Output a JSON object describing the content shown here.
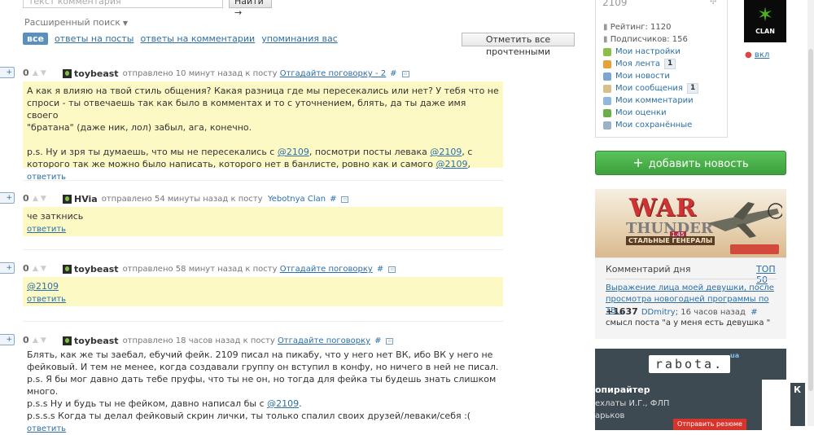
{
  "search": {
    "placeholder": "текст комментария",
    "button": "Найти →"
  },
  "advanced_search": "Расширенный поиск",
  "filters": {
    "active": "все",
    "items": [
      "ответы на посты",
      "ответы на комментарии",
      "упоминания вас"
    ]
  },
  "mark_all_read": "Отметить все прочтенными",
  "comments": [
    {
      "score": "0",
      "user": "toybeast",
      "meta": "отправлено 10 минут назад к посту",
      "post_link": "Отгадайте поговорку - 2",
      "lines": [
        "А как я влияю на твой стиль общения? Какая разница где мы пересекались или нет? У тебя что не",
        "спроси - ты отвечаешь так как было в комментах и то с уточнением, блять, да ты даже имя своего",
        "\"братана\" (даже ник, лол) забыл, ага, конечно."
      ],
      "ps_prefix": "p.s. Ну и зря ты думаешь, что мы не пересекались с ",
      "mention": "@2109",
      "ps_mid": ", посмотри посты левака ",
      "mention2": "@2109",
      "ps_mid2": ", с",
      "ps_line2": "которого так же можно было написать, которого нет в банлисте, ровно как и самого ",
      "mention3": "@2109",
      "ps_end": ",",
      "reply": "ответить"
    },
    {
      "score": "0",
      "user": "HVia",
      "meta": "отправлено 54 минуты назад к посту",
      "post_link": "Yebotnya Clan",
      "text": "че заткнись",
      "reply": "ответить"
    },
    {
      "score": "0",
      "user": "toybeast",
      "meta": "отправлено 58 минут назад к посту",
      "post_link": "Отгадайте поговорку",
      "mention": "@2109",
      "reply": "ответить"
    },
    {
      "score": "0",
      "user": "toybeast",
      "meta": "отправлено 18 часов назад к посту",
      "post_link": "Отгадайте поговорку",
      "lines": [
        "Блять, как же ты заебал, ебучий фейк. 2109 писал на пикабу, что у него нет ВК, ибо ВК у него не",
        "фейковый. И тем не менее, когда создавали группу он вступил в конфу, но ничего в ней не писал.",
        "p.s. Я бы мог давно дать тебе пруфы, что ты не он, но тогда для фейка ты будешь знать слишком",
        "много."
      ],
      "pss_prefix": "p.s.s Ну и будь ты не фейком, давно написал бы с ",
      "mention": "@2109",
      "pss_end": ".",
      "psss": "p.s.s.s Когда ты делал фейковый скрин лички, ты только спалил своих друзей/леваки/себя :(",
      "reply": "ответить"
    }
  ],
  "plus_label": "+",
  "hash": "#",
  "user_panel": {
    "username": "2109",
    "rating": "Рейтинг: 1120",
    "subscribers": "Подписчиков: 156",
    "menu": [
      {
        "label": "Мои настройки",
        "icon": "gear-icon",
        "badge": ""
      },
      {
        "label": "Моя лента",
        "icon": "feed-icon",
        "badge": "1"
      },
      {
        "label": "Мои новости",
        "icon": "news-icon",
        "badge": ""
      },
      {
        "label": "Мои сообщения",
        "icon": "mail-icon",
        "badge": "1"
      },
      {
        "label": "Мои комментарии",
        "icon": "comment-icon",
        "badge": ""
      },
      {
        "label": "Мои оценки",
        "icon": "rating-icon",
        "badge": ""
      },
      {
        "label": "Мои сохранённые",
        "icon": "saved-icon",
        "badge": ""
      }
    ]
  },
  "clan": {
    "name": "CLAN",
    "toggle": "вкл"
  },
  "add_news": "добавить новость",
  "banner": {
    "title": "WAR",
    "subtitle": "THUNDER",
    "tag": "СТАЛЬНЫЕ ГЕНЕРАЛЫ",
    "version": "1.45"
  },
  "comment_of_day": {
    "title": "Комментарий дня",
    "top": "ТОП 50",
    "link": "Выражение лица моей девушки, после просмотра новогодней программы по ТВ...",
    "score": "+1637",
    "author": "DDmitry",
    "time": "; 16 часов назад",
    "hash": "#",
    "text": "смысл поста \"а у меня есть девушка \""
  },
  "rabota": {
    "logo": "rabota.",
    "ua": "ua",
    "job": "опирайтер",
    "line1": "ехлаты И.Г., ФЛП",
    "line2": "арьков",
    "button": "Отправить резюме",
    "right_letter": "К"
  },
  "colors": {
    "accent": "#2b6fa8",
    "highlight": "#fdf9c4",
    "green": "#4caf50"
  }
}
